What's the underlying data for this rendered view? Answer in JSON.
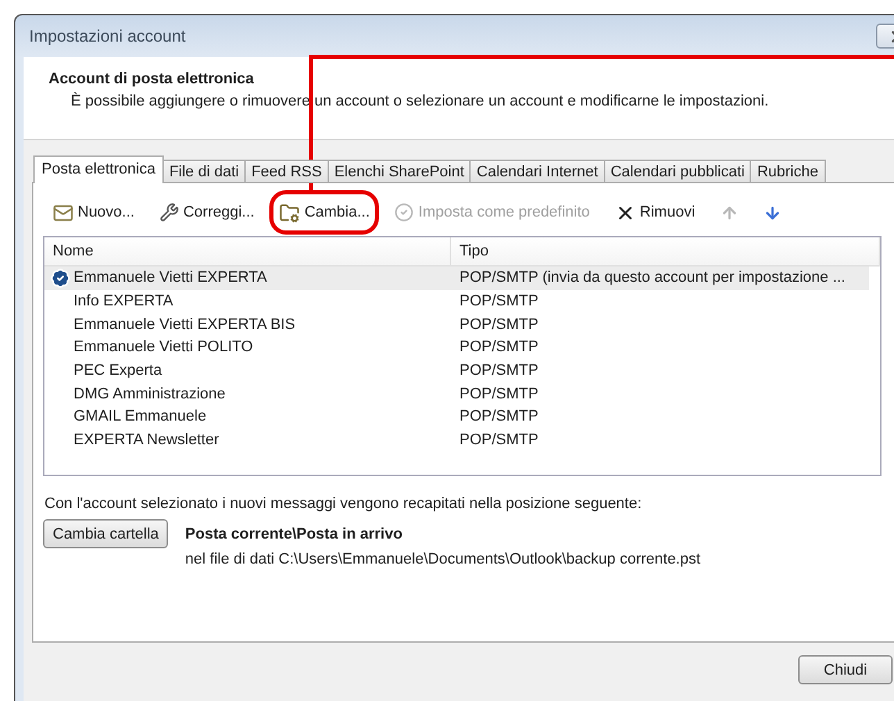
{
  "window": {
    "title": "Impostazioni account"
  },
  "header": {
    "title": "Account di posta elettronica",
    "description": "È possibile aggiungere o rimuovere un account o selezionare un account e modificarne le impostazioni."
  },
  "tabs": [
    {
      "label": "Posta elettronica",
      "selected": true
    },
    {
      "label": "File di dati",
      "selected": false
    },
    {
      "label": "Feed RSS",
      "selected": false
    },
    {
      "label": "Elenchi SharePoint",
      "selected": false
    },
    {
      "label": "Calendari Internet",
      "selected": false
    },
    {
      "label": "Calendari pubblicati",
      "selected": false
    },
    {
      "label": "Rubriche",
      "selected": false
    }
  ],
  "toolbar": [
    {
      "kind": "new",
      "label": "Nuovo...",
      "disabled": false,
      "annotated": false
    },
    {
      "kind": "repair",
      "label": "Correggi...",
      "disabled": false,
      "annotated": false
    },
    {
      "kind": "change",
      "label": "Cambia...",
      "disabled": false,
      "annotated": true
    },
    {
      "kind": "default",
      "label": "Imposta come predefinito",
      "disabled": true,
      "annotated": false
    },
    {
      "kind": "remove",
      "label": "Rimuovi",
      "disabled": false,
      "annotated": false
    },
    {
      "kind": "up",
      "disabled": true,
      "annotated": false
    },
    {
      "kind": "down",
      "disabled": false,
      "annotated": false
    }
  ],
  "list": {
    "columns": [
      "Nome",
      "Tipo"
    ],
    "rows": [
      {
        "name": "Emmanuele Vietti EXPERTA",
        "type": "POP/SMTP (invia da questo account per impostazione ...",
        "default": true,
        "selected": true
      },
      {
        "name": "Info EXPERTA",
        "type": "POP/SMTP",
        "default": false,
        "selected": false
      },
      {
        "name": "Emmanuele Vietti EXPERTA BIS",
        "type": "POP/SMTP",
        "default": false,
        "selected": false
      },
      {
        "name": "Emmanuele Vietti POLITO",
        "type": "POP/SMTP",
        "default": false,
        "selected": false
      },
      {
        "name": "PEC Experta",
        "type": "POP/SMTP",
        "default": false,
        "selected": false
      },
      {
        "name": "DMG Amministrazione",
        "type": "POP/SMTP",
        "default": false,
        "selected": false
      },
      {
        "name": "GMAIL Emmanuele",
        "type": "POP/SMTP",
        "default": false,
        "selected": false
      },
      {
        "name": "EXPERTA Newsletter",
        "type": "POP/SMTP",
        "default": false,
        "selected": false
      }
    ]
  },
  "delivery": {
    "note": "Con l'account selezionato i nuovi messaggi vengono recapitati nella posizione seguente:",
    "button": "Cambia cartella",
    "folder": "Posta corrente\\Posta in arrivo",
    "file": "nel file di dati C:\\Users\\Emmanuele\\Documents\\Outlook\\backup corrente.pst"
  },
  "close_button": "Chiudi"
}
